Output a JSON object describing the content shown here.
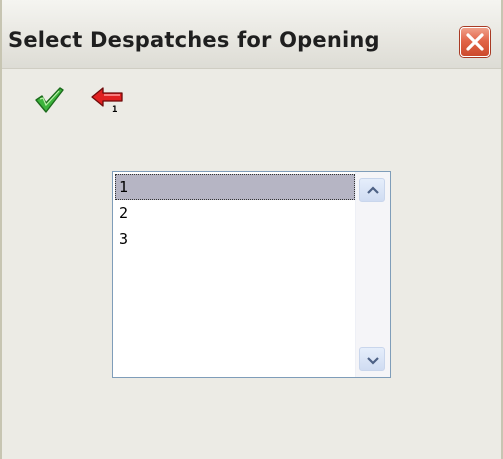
{
  "window": {
    "title": "Select Despatches for Opening"
  },
  "toolbar": {
    "confirm_icon": "checkmark-icon",
    "back_icon": "back-arrow-icon",
    "back_badge": "1"
  },
  "list": {
    "items": [
      "1",
      "2",
      "3"
    ],
    "selected_index": 0
  },
  "colors": {
    "selection": "#b6b5c4",
    "close_button": "#e2664a",
    "confirm_check": "#3cb43c",
    "back_arrow": "#e02020"
  }
}
